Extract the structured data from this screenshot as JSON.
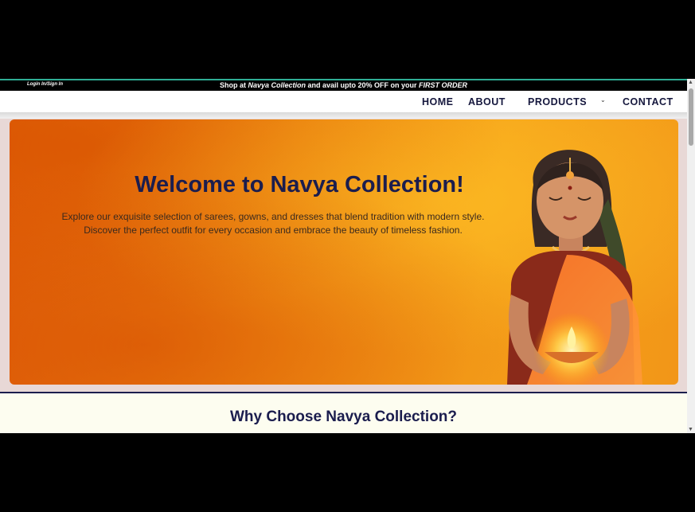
{
  "promo": {
    "login_label": "Login In/Sign In",
    "text_prefix": "Shop at ",
    "text_brand": "Navya Collection",
    "text_middle": " and avail upto 20% OFF on your ",
    "text_offer": "FIRST ORDER"
  },
  "nav": {
    "home": "HOME",
    "about": "ABOUT",
    "products": "PRODUCTS",
    "products_chevron": "⌄",
    "contact": "CONTACT"
  },
  "hero": {
    "title": "Welcome to Navya Collection!",
    "description_line1": "Explore our exquisite selection of sarees, gowns, and dresses that blend tradition with modern style.",
    "description_line2": "Discover the perfect outfit for every occasion and embrace the beauty of timeless fashion."
  },
  "why": {
    "title": "Why Choose Navya Collection?"
  },
  "scrollbar": {
    "up_arrow": "▲",
    "down_arrow": "▼"
  },
  "colors": {
    "brand_navy": "#1b1d4e",
    "promo_accent": "#2fae95",
    "hero_orange": "#f08c12"
  }
}
